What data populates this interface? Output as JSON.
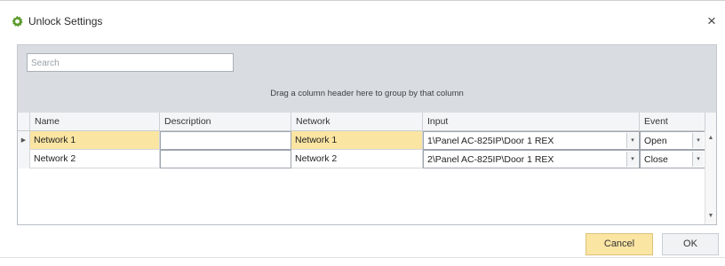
{
  "window": {
    "title": "Unlock Settings",
    "close_glyph": "×"
  },
  "panel": {
    "search_placeholder": "Search",
    "group_hint": "Drag a column header here to group by that column"
  },
  "grid": {
    "columns": [
      "Name",
      "Description",
      "Network",
      "Input",
      "Event"
    ],
    "rows": [
      {
        "indicator": "▶",
        "name": "Network 1",
        "description": "",
        "network": "Network 1",
        "input": "1\\Panel  AC-825IP\\Door 1 REX",
        "event": "Open",
        "selected": true
      },
      {
        "indicator": "",
        "name": "Network 2",
        "description": "",
        "network": "Network 2",
        "input": "2\\Panel  AC-825IP\\Door 1 REX",
        "event": "Close",
        "selected": false
      }
    ],
    "dropdown_glyph": "▾",
    "scroll_up_glyph": "▲",
    "scroll_down_glyph": "▼"
  },
  "buttons": {
    "cancel": "Cancel",
    "ok": "OK"
  },
  "icons": {
    "title_icon": "gear-icon",
    "accent_color": "#fbe5a3",
    "icon_color": "#5a9a2a"
  }
}
